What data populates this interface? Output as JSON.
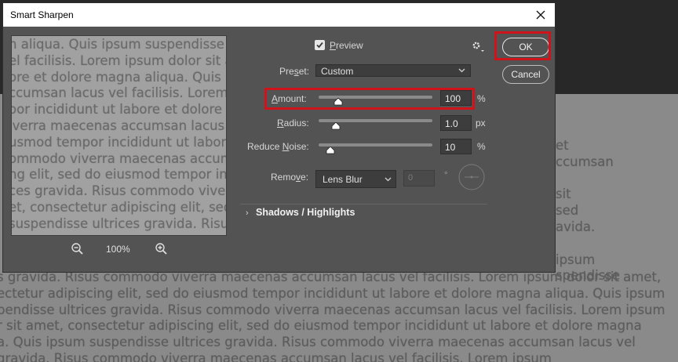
{
  "dialog": {
    "title": "Smart Sharpen",
    "close_icon": "close-icon"
  },
  "preview": {
    "checkbox_label": "Preview",
    "checked": true,
    "zoom_level": "100%",
    "zoom_out_icon": "zoom-out-icon",
    "zoom_in_icon": "zoom-in-icon",
    "text_lines": [
      "n aliqua. Quis ipsum suspendisse ult",
      "el facilisis. Lorem ipsum dolor sit am",
      "ore et dolore magna aliqua. Quis ip",
      "ccumsan lacus vel facilisis. Lorem ip",
      "oor incididunt ut labore et dolore m",
      "iverra maecenas accumsan lacus vel fa",
      "usmod tempor incididunt ut labore",
      "ommodo viverra maecenas accumsa",
      "ng elit, sed do eiusmod tempor incid",
      "ces gravida. Risus commodo viverra",
      "et, consectetur adipiscing elit, sed do",
      "suspendisse ultrices gravida. Risus"
    ]
  },
  "settings": {
    "preset_label": "Preset:",
    "preset_value": "Custom",
    "amount_label": "Amount:",
    "amount_value": "100",
    "amount_unit": "%",
    "amount_fraction": 0.17,
    "radius_label": "Radius:",
    "radius_value": "1.0",
    "radius_unit": "px",
    "radius_fraction": 0.15,
    "noise_label": "Reduce Noise:",
    "noise_value": "10",
    "noise_unit": "%",
    "noise_fraction": 0.1,
    "remove_label": "Remove:",
    "remove_value": "Lens Blur",
    "angle_value": "0",
    "angle_unit": "°",
    "gear_icon": "gear-icon",
    "shadows_label": "Shadows / Highlights"
  },
  "buttons": {
    "ok": "OK",
    "cancel": "Cancel"
  },
  "background_text": {
    "right_lines": [
      "et",
      "ccumsan",
      "",
      "sit",
      "sed",
      "avida.",
      "",
      "ipsum",
      "spendisse"
    ],
    "main_lines": [
      "s gravida. Risus commodo viverra maecenas accumsan lacus vel facilisis. Lorem ipsum dolor sit amet,",
      "ectetur adipiscing elit, sed do eiusmod tempor incididunt ut labore et dolore magna aliqua. Quis ipsum",
      "pendisse ultrices gravida. Risus commodo viverra maecenas accumsan lacus vel facilisis. Lorem ipsum",
      "r sit amet, consectetur adipiscing elit, sed do eiusmod tempor incididunt ut labore et dolore magna",
      "a. Quis ipsum suspendisse ultrices gravida. Risus commodo viverra maecenas accumsan lacus vel",
      "gravida. Risus commodo viverra maecenas accumsan lacus vel facilisis. Lorem ipsum"
    ]
  },
  "colors": {
    "highlight": "#d0121b",
    "dialog_bg": "#535353",
    "titlebar_bg": "#ffffff"
  }
}
